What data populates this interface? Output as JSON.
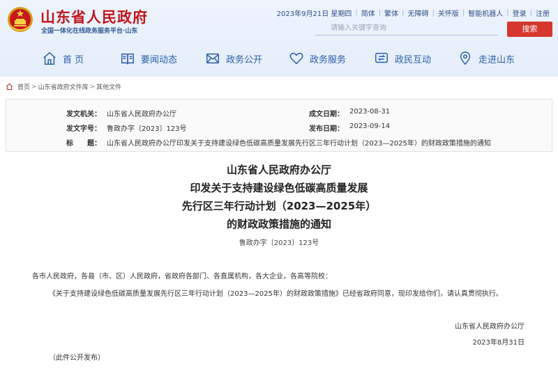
{
  "header": {
    "site_title": "山东省人民政府",
    "site_subtitle": "全国一体化在线政务服务平台·山东",
    "toplinks": [
      "2023年9月21日 星期四",
      "简体",
      "繁体",
      "无障碍",
      "关怀版",
      "智能机器人",
      "登录",
      "注册"
    ],
    "search_placeholder": "请输入关键字查询",
    "search_button": "搜索"
  },
  "nav": [
    {
      "label": "首 页",
      "icon": "home-icon"
    },
    {
      "label": "要闻动态",
      "icon": "book-icon"
    },
    {
      "label": "政务公开",
      "icon": "envelope-icon"
    },
    {
      "label": "政务服务",
      "icon": "heart-icon"
    },
    {
      "label": "政民互动",
      "icon": "exchange-icon"
    },
    {
      "label": "走进山东",
      "icon": "location-icon"
    }
  ],
  "breadcrumb": [
    "首页",
    "山东省政府文件库",
    "其他文件"
  ],
  "meta": {
    "issuer_label": "发文机关：",
    "issuer": "山东省人民政府办公厅",
    "date_created_label": "成文日期：",
    "date_created": "2023-08-31",
    "docno_label": "发文字号：",
    "docno": "鲁政办字〔2023〕123号",
    "date_published_label": "发布日期：",
    "date_published": "2023-09-14",
    "title_label": "标　　题：",
    "title": "山东省人民政府办公厅印发关于支持建设绿色低碳高质量发展先行区三年行动计划（2023—2025年）的财政政策措施的通知"
  },
  "article": {
    "title_lines": [
      "山东省人民政府办公厅",
      "印发关于支持建设绿色低碳高质量发展",
      "先行区三年行动计划（2023—2025年）",
      "的财政政策措施的通知"
    ],
    "docno": "鲁政办字〔2023〕123号",
    "salutation": "各市人民政府，各县（市、区）人民政府，省政府各部门、各直属机构，各大企业，各高等院校：",
    "body": "《关于支持建设绿色低碳高质量发展先行区三年行动计划（2023—2025年）的财政政策措施》已经省政府同意，现印发给你们，请认真贯彻执行。",
    "signature": "山东省人民政府办公厅",
    "sign_date": "2023年8月31日",
    "note": "（此件公开发布）"
  },
  "colors": {
    "brand_red": "#c0151b",
    "nav_blue": "#2b5ea8",
    "search_red": "#d6372d"
  }
}
